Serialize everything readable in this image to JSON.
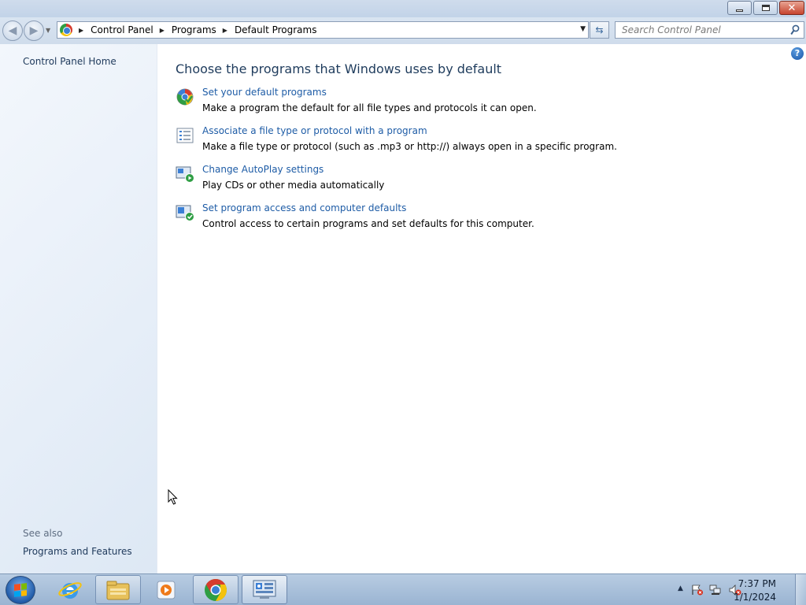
{
  "window": {
    "caption_buttons": [
      "minimize",
      "maximize",
      "close"
    ]
  },
  "address": {
    "breadcrumbs": [
      "Control Panel",
      "Programs",
      "Default Programs"
    ],
    "search_placeholder": "Search Control Panel"
  },
  "left_pane": {
    "home_link": "Control Panel Home",
    "see_also_heading": "See also",
    "see_also_links": [
      "Programs and Features"
    ]
  },
  "main": {
    "title": "Choose the programs that Windows uses by default",
    "tasks": [
      {
        "icon": "default-programs-icon",
        "link": "Set your default programs",
        "description": "Make a program the default for all file types and protocols it can open."
      },
      {
        "icon": "file-association-icon",
        "link": "Associate a file type or protocol with a program",
        "description": "Make a file type or protocol (such as .mp3 or http://) always open in a specific program."
      },
      {
        "icon": "autoplay-icon",
        "link": "Change AutoPlay settings",
        "description": "Play CDs or other media automatically"
      },
      {
        "icon": "program-access-icon",
        "link": "Set program access and computer defaults",
        "description": "Control access to certain programs and set defaults for this computer."
      }
    ]
  },
  "taskbar": {
    "buttons": [
      "internet-explorer-icon",
      "windows-explorer-icon",
      "media-player-icon",
      "chrome-icon",
      "control-panel-icon"
    ],
    "active": "control-panel-icon",
    "clock": {
      "time": "7:37 PM",
      "date": "1/1/2024"
    }
  },
  "colors": {
    "link": "#1e5ca6",
    "title": "#1e3b5c",
    "left_link": "#1e395b",
    "see_also": "#5f6e82"
  }
}
